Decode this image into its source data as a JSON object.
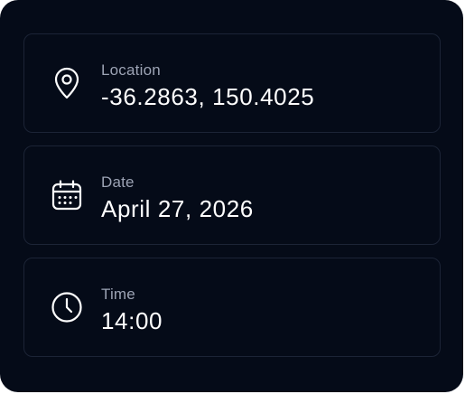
{
  "cards": [
    {
      "icon": "map-pin-icon",
      "label": "Location",
      "value": "-36.2863, 150.4025"
    },
    {
      "icon": "calendar-icon",
      "label": "Date",
      "value": "April 27, 2026"
    },
    {
      "icon": "clock-icon",
      "label": "Time",
      "value": "14:00"
    }
  ],
  "colors": {
    "background": "#050b18",
    "card_border": "#1c2436",
    "label": "#9ca3b4",
    "value": "#ffffff"
  }
}
